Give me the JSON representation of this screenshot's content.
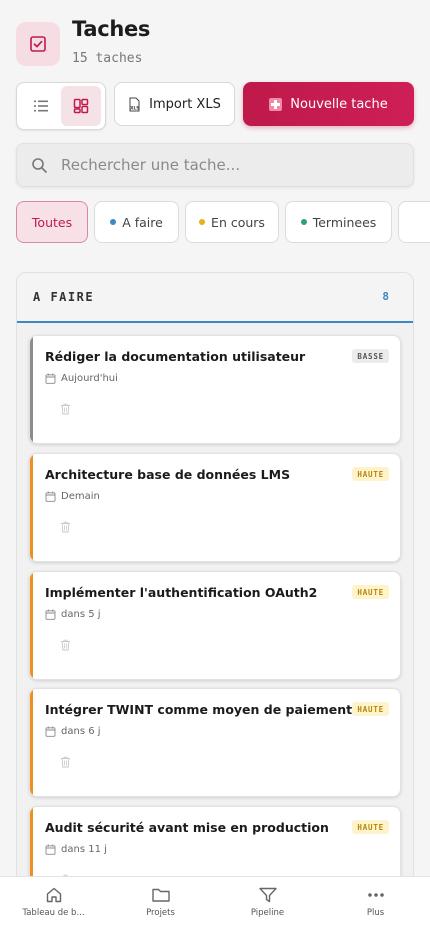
{
  "header": {
    "title": "Taches",
    "subtitle": "15 taches",
    "icon": "checkbox-icon"
  },
  "toolbar": {
    "list_view_icon": "list-icon",
    "board_view_icon": "kanban-icon",
    "import_label": "Import XLS",
    "import_icon": "xls-file-icon",
    "new_label": "Nouvelle tache"
  },
  "search": {
    "placeholder": "Rechercher une tache..."
  },
  "filters": [
    {
      "label": "Toutes",
      "active": true
    },
    {
      "label": "A faire",
      "dot_color": "#3e88c4"
    },
    {
      "label": "En cours",
      "dot_color": "#e2b21b"
    },
    {
      "label": "Terminees",
      "dot_color": "#2ea36f"
    },
    {
      "label": ""
    }
  ],
  "column": {
    "title": "A FAIRE",
    "count": "8",
    "accent": "#3e88c4"
  },
  "tasks": [
    {
      "title": "Rédiger la documentation utilisateur",
      "priority": "BASSE",
      "date": "Aujourd'hui",
      "bar_color": "#8c8c8c"
    },
    {
      "title": "Architecture base de données LMS",
      "priority": "HAUTE",
      "date": "Demain",
      "bar_color": "#ef8f1f"
    },
    {
      "title": "Implémenter l'authentification OAuth2",
      "priority": "HAUTE",
      "date": "dans 5 j",
      "bar_color": "#ef8f1f"
    },
    {
      "title": "Intégrer TWINT comme moyen de paiement",
      "priority": "HAUTE",
      "date": "dans 6 j",
      "bar_color": "#ef8f1f"
    },
    {
      "title": "Audit sécurité avant mise en production",
      "priority": "HAUTE",
      "date": "dans 11 j",
      "bar_color": "#ef8f1f"
    }
  ],
  "nav": [
    {
      "label": "Tableau de b...",
      "icon": "home-icon"
    },
    {
      "label": "Projets",
      "icon": "folder-icon"
    },
    {
      "label": "Pipeline",
      "icon": "filter-icon"
    },
    {
      "label": "Plus",
      "icon": "more-icon"
    }
  ],
  "colors": {
    "brand": "#c01a4b",
    "brand_light": "#f5dde3",
    "high_priority": "#ef8f1f"
  }
}
